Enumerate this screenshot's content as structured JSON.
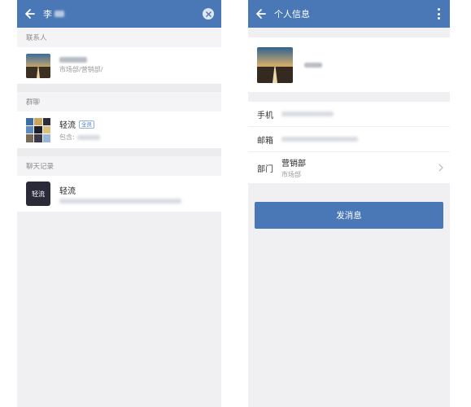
{
  "colors": {
    "appbar": "#4a78b6",
    "background": "#f0f0f2",
    "button": "#4a78b6",
    "chat_icon_bg": "#2b2a39"
  },
  "search_screen": {
    "query_prefix": "李",
    "back_icon": "arrow-left-icon",
    "clear_icon": "clear-circle-icon",
    "sections": {
      "contacts": "联系人",
      "groups": "群聊",
      "chat_records": "聊天记录"
    },
    "contact": {
      "department": "市场部/营销部/"
    },
    "group": {
      "name": "轻流",
      "badge": "全员",
      "members_prefix": "包含:"
    },
    "chat": {
      "icon_text": "轻流",
      "name": "轻流"
    }
  },
  "profile_screen": {
    "title": "个人信息",
    "back_icon": "arrow-left-icon",
    "more_icon": "more-vertical-icon",
    "fields": {
      "phone_label": "手机",
      "email_label": "邮箱",
      "department_label": "部门"
    },
    "department": {
      "name": "营销部",
      "parent": "市场部"
    },
    "send_button": "发消息"
  }
}
